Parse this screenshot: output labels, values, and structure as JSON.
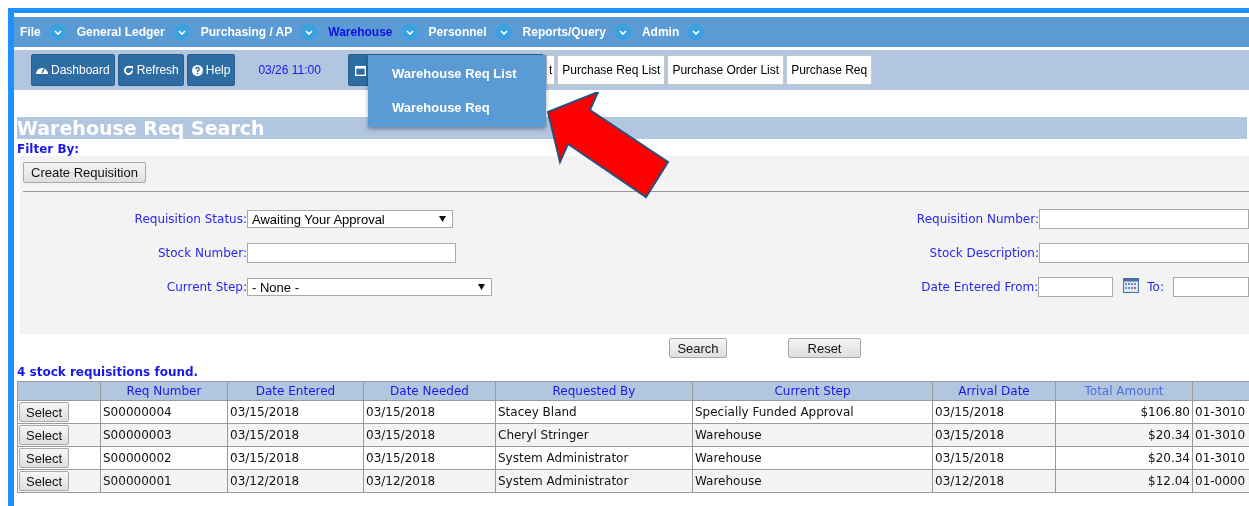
{
  "menu": [
    {
      "label": "File",
      "selected": false
    },
    {
      "label": "General Ledger",
      "selected": false
    },
    {
      "label": "Purchasing / AP",
      "selected": false
    },
    {
      "label": "Warehouse",
      "selected": true
    },
    {
      "label": "Personnel",
      "selected": false
    },
    {
      "label": "Reports/Query",
      "selected": false
    },
    {
      "label": "Admin",
      "selected": false
    }
  ],
  "dropdown": [
    "Warehouse Req List",
    "Warehouse Req"
  ],
  "toolbar": {
    "buttons": [
      {
        "kind": "dashboard",
        "label": "Dashboard"
      },
      {
        "kind": "refresh",
        "label": "Refresh"
      },
      {
        "kind": "help",
        "label": "Help"
      }
    ],
    "datetime": "03/26 11:00"
  },
  "tabs": [
    {
      "label": "t"
    },
    {
      "label": "Purchase Req List"
    },
    {
      "label": "Purchase Order List"
    },
    {
      "label": "Purchase Req"
    }
  ],
  "title": "Warehouse Req Search",
  "filter_label": "Filter By:",
  "create_button": "Create Requisition",
  "filters_left": [
    {
      "kind": "select",
      "label": "Requisition Status:",
      "value": "Awaiting Your Approval",
      "wide": false
    },
    {
      "kind": "input",
      "label": "Stock Number:"
    },
    {
      "kind": "select",
      "label": "Current Step:",
      "value": "- None -",
      "wide": true
    }
  ],
  "filters_right": [
    {
      "kind": "input",
      "label": "Requisition Number:"
    },
    {
      "kind": "input",
      "label": "Stock Description:"
    },
    {
      "kind": "daterange",
      "label": "Date Entered From:",
      "to_label": "To:"
    }
  ],
  "search_button": "Search",
  "reset_button": "Reset",
  "result_count": "4 stock requisitions found.",
  "table": {
    "columns": [
      "",
      "Req Number",
      "Date Entered",
      "Date Needed",
      "Requested By",
      "Current Step",
      "Arrival Date",
      "Total Amount",
      ""
    ],
    "rows": [
      [
        "Select",
        "S00000004",
        "03/15/2018",
        "03/15/2018",
        "Stacey Bland",
        "Specially Funded Approval",
        "03/15/2018",
        "$106.80",
        "01-3010"
      ],
      [
        "Select",
        "S00000003",
        "03/15/2018",
        "03/15/2018",
        "Cheryl Stringer",
        "Warehouse",
        "03/15/2018",
        "$20.34",
        "01-3010"
      ],
      [
        "Select",
        "S00000002",
        "03/15/2018",
        "03/15/2018",
        "System Administrator",
        "Warehouse",
        "03/15/2018",
        "$20.34",
        "01-3010"
      ],
      [
        "Select",
        "S00000001",
        "03/12/2018",
        "03/12/2018",
        "System Administrator",
        "Warehouse",
        "03/12/2018",
        "$12.04",
        "01-0000"
      ]
    ]
  }
}
